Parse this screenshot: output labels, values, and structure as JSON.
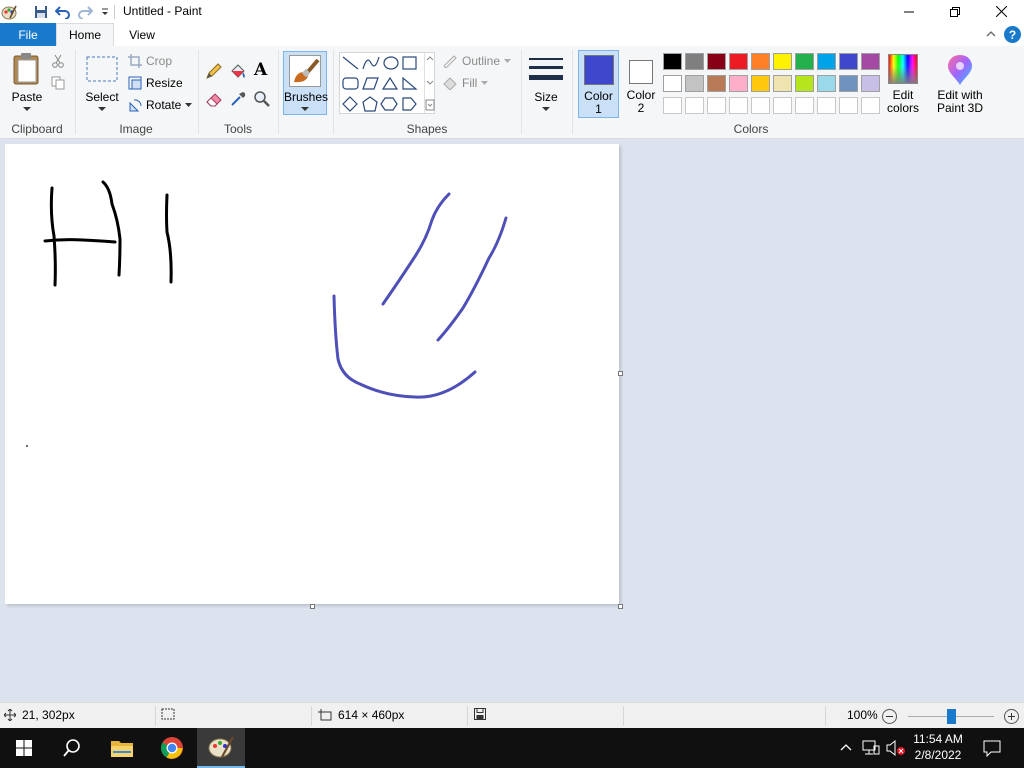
{
  "window": {
    "title": "Untitled - Paint"
  },
  "tabs": [
    {
      "label": "File"
    },
    {
      "label": "Home"
    },
    {
      "label": "View"
    }
  ],
  "clipboard": {
    "paste_label": "Paste",
    "group_label": "Clipboard"
  },
  "image": {
    "select_label": "Select",
    "crop_label": "Crop",
    "resize_label": "Resize",
    "rotate_label": "Rotate",
    "group_label": "Image"
  },
  "tools": {
    "group_label": "Tools"
  },
  "brushes": {
    "label": "Brushes"
  },
  "shapes": {
    "outline_label": "Outline",
    "fill_label": "Fill",
    "group_label": "Shapes"
  },
  "size": {
    "label": "Size"
  },
  "colors": {
    "color1_label": "Color",
    "color1_num": "1",
    "color2_label": "Color",
    "color2_num": "2",
    "color1_value": "#3f48cc",
    "color2_value": "#ffffff",
    "edit_colors_line1": "Edit",
    "edit_colors_line2": "colors",
    "paint3d_line1": "Edit with",
    "paint3d_line2": "Paint 3D",
    "group_label": "Colors",
    "palette_row1": [
      "#000000",
      "#7f7f7f",
      "#880015",
      "#ed1c24",
      "#ff7f27",
      "#fff200",
      "#22b14c",
      "#00a2e8",
      "#3f48cc",
      "#a349a4"
    ],
    "palette_row2": [
      "#ffffff",
      "#c3c3c3",
      "#b97a57",
      "#ffaec9",
      "#ffc90e",
      "#efe4b0",
      "#b5e61d",
      "#99d9ea",
      "#7092be",
      "#c8bfe7"
    ],
    "palette_row3": [
      "#ffffff",
      "#ffffff",
      "#ffffff",
      "#ffffff",
      "#ffffff",
      "#ffffff",
      "#ffffff",
      "#ffffff",
      "#ffffff",
      "#ffffff"
    ]
  },
  "drawing": {
    "black_stroke": "#000000",
    "blue_stroke": "#4f4fb8"
  },
  "status": {
    "cursor_pos": "21, 302px",
    "canvas_size": "614 × 460px",
    "zoom": "100%",
    "zoom_slider_fraction": 0.5
  },
  "taskbar": {
    "time": "11:54 AM",
    "date": "2/8/2022"
  }
}
